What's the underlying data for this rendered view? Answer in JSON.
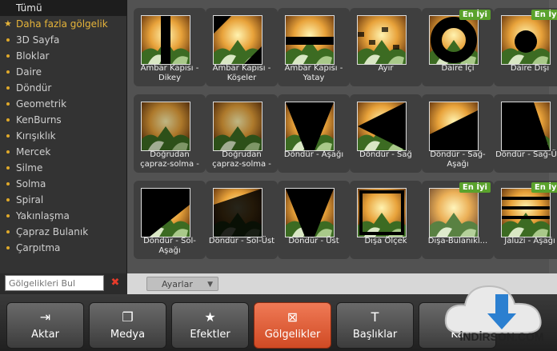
{
  "sidebar": {
    "items": [
      {
        "label": "Tümü",
        "kind": "all"
      },
      {
        "label": "Daha fazla gölgelik",
        "kind": "selected"
      },
      {
        "label": "3D Sayfa"
      },
      {
        "label": "Bloklar"
      },
      {
        "label": "Daire"
      },
      {
        "label": "Döndür"
      },
      {
        "label": "Geometrik"
      },
      {
        "label": "KenBurns"
      },
      {
        "label": "Kırışıklık"
      },
      {
        "label": "Mercek"
      },
      {
        "label": "Silme"
      },
      {
        "label": "Solma"
      },
      {
        "label": "Spiral"
      },
      {
        "label": "Yakınlaşma"
      },
      {
        "label": "Çapraz Bulanık"
      },
      {
        "label": "Çarpıtma"
      }
    ],
    "search_placeholder": "Gölgelikleri Bul"
  },
  "settings_label": "Ayarlar",
  "badge_text": "En İyi",
  "tiles": [
    {
      "label": "Ambar Kapısı - Dikey",
      "style": "v"
    },
    {
      "label": "Ambar Kapısı - Köşeler",
      "style": "c"
    },
    {
      "label": "Ambar Kapısı - Yatay",
      "style": "h"
    },
    {
      "label": "Ayır",
      "style": "split"
    },
    {
      "label": "Daire İçi",
      "style": "circ",
      "badge": true
    },
    {
      "label": "Daire Dışı",
      "style": "circout",
      "badge": true
    },
    {
      "label": "Doğrudan çapraz-solma -",
      "style": "fade"
    },
    {
      "label": "Doğrudan çapraz-solma -",
      "style": "fade"
    },
    {
      "label": "Döndür - Aşağı",
      "style": "rot"
    },
    {
      "label": "Döndür - Sağ",
      "style": "rot2"
    },
    {
      "label": "Döndür - Sağ-Aşağı",
      "style": "rot3"
    },
    {
      "label": "Döndür - Sağ-Üst",
      "style": "rot4"
    },
    {
      "label": "Döndür - Sol-Aşağı",
      "style": "rot5"
    },
    {
      "label": "Döndür - Sol-Üst",
      "style": "rot6"
    },
    {
      "label": "Döndür - Üst",
      "style": "rot"
    },
    {
      "label": "Dışa Ölçek",
      "style": "scale"
    },
    {
      "label": "Dışa-Bulanıkl...",
      "style": "blur",
      "badge": true
    },
    {
      "label": "Jaluzi - Aşağı",
      "style": "blind",
      "badge": true
    }
  ],
  "nav": [
    {
      "label": "Aktar",
      "icon": "import-icon",
      "glyph": "⇥"
    },
    {
      "label": "Medya",
      "icon": "media-icon",
      "glyph": "❐"
    },
    {
      "label": "Efektler",
      "icon": "star-icon",
      "glyph": "★"
    },
    {
      "label": "Gölgelikler",
      "icon": "transition-icon",
      "glyph": "⊠",
      "active": true
    },
    {
      "label": "Başlıklar",
      "icon": "text-icon",
      "glyph": "T"
    },
    {
      "label": "Ka",
      "icon": "export-icon",
      "glyph": "⇪"
    }
  ],
  "watermark": "İNDİRSON.COM"
}
